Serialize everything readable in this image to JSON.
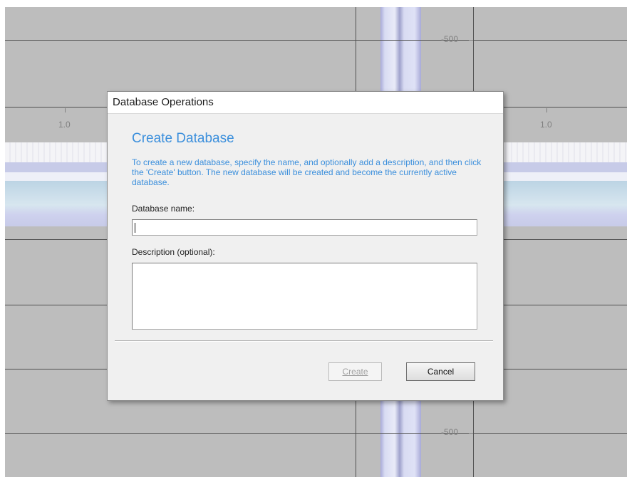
{
  "background": {
    "axis_labels": {
      "x_top_left": "1.0",
      "x_top_right": "1.0",
      "y_top": "-500",
      "y_bottom": "-500"
    }
  },
  "dialog": {
    "title": "Database Operations",
    "heading": "Create Database",
    "instructions": "To create a new database, specify the name, and optionally add a description, and then click the 'Create' button. The new database will be created and become the currently active database.",
    "name_label": "Database name:",
    "name_value": "",
    "description_label": "Description (optional):",
    "description_value": "",
    "create_button": "Create",
    "create_button_enabled": false,
    "cancel_button": "Cancel"
  },
  "colors": {
    "heading": "#3b8fdc",
    "workspace": "#bdbdbd"
  }
}
